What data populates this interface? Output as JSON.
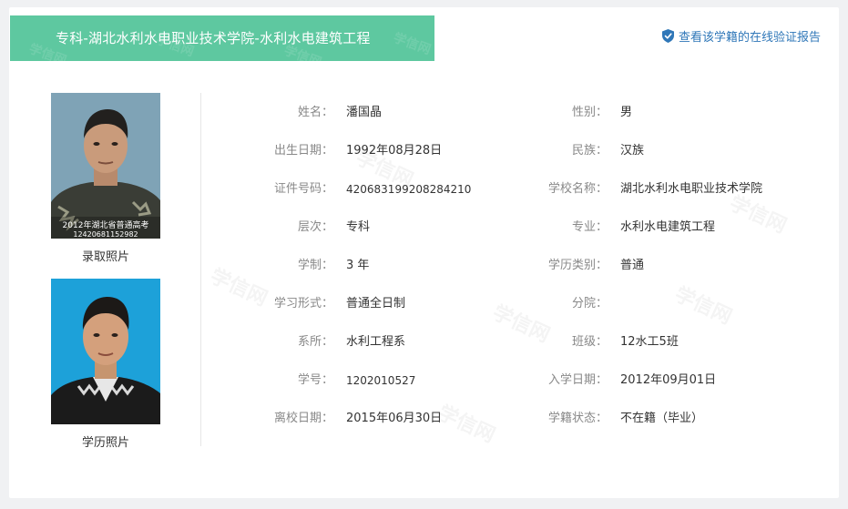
{
  "header": {
    "title": "专科-湖北水利水电职业技术学院-水利水电建筑工程",
    "verify_link": "查看该学籍的在线验证报告"
  },
  "photos": {
    "admission_caption": "录取照片",
    "admission_stamp_line1": "2012年湖北省普通高考",
    "admission_stamp_line2": "12420681152982",
    "degree_caption": "学历照片"
  },
  "watermark_text": "学信网",
  "fields": [
    {
      "label": "姓名：",
      "value": "潘国晶"
    },
    {
      "label": "性别：",
      "value": "男"
    },
    {
      "label": "出生日期：",
      "value": "1992年08月28日"
    },
    {
      "label": "民族：",
      "value": "汉族"
    },
    {
      "label": "证件号码：",
      "value": "420683199208284210"
    },
    {
      "label": "学校名称：",
      "value": "湖北水利水电职业技术学院"
    },
    {
      "label": "层次：",
      "value": "专科"
    },
    {
      "label": "专业：",
      "value": "水利水电建筑工程"
    },
    {
      "label": "学制：",
      "value": "3 年"
    },
    {
      "label": "学历类别：",
      "value": "普通"
    },
    {
      "label": "学习形式：",
      "value": "普通全日制"
    },
    {
      "label": "分院：",
      "value": ""
    },
    {
      "label": "系所：",
      "value": "水利工程系"
    },
    {
      "label": "班级：",
      "value": "12水工5班"
    },
    {
      "label": "学号：",
      "value": "1202010527"
    },
    {
      "label": "入学日期：",
      "value": "2012年09月01日"
    },
    {
      "label": "离校日期：",
      "value": "2015年06月30日"
    },
    {
      "label": "学籍状态：",
      "value": "不在籍（毕业）"
    }
  ],
  "colors": {
    "banner": "#5ec8a0",
    "link": "#2f77b8",
    "label": "#888888",
    "value": "#333333"
  }
}
